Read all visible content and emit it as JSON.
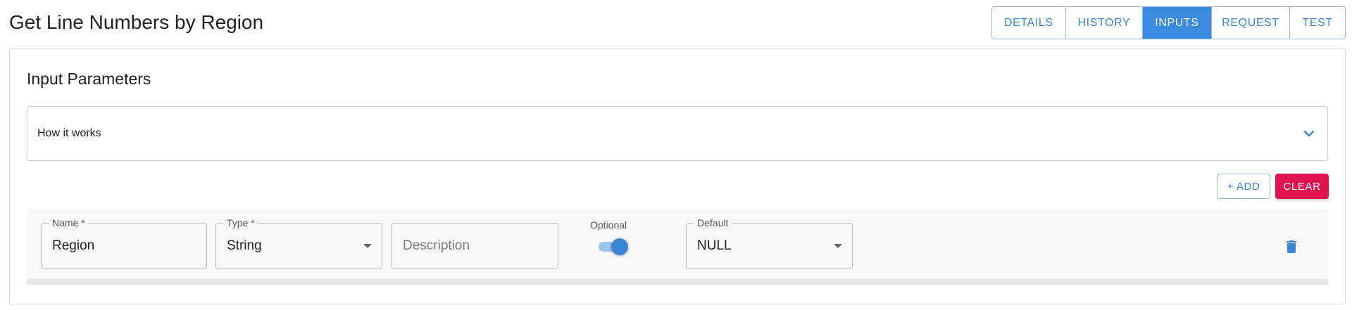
{
  "page": {
    "title": "Get Line Numbers by Region"
  },
  "tabs": [
    {
      "label": "DETAILS",
      "active": false
    },
    {
      "label": "HISTORY",
      "active": false
    },
    {
      "label": "INPUTS",
      "active": true
    },
    {
      "label": "REQUEST",
      "active": false
    },
    {
      "label": "TEST",
      "active": false
    }
  ],
  "section": {
    "title": "Input Parameters"
  },
  "accordion": {
    "label": "How it works",
    "icon": "chevron-down-icon",
    "expanded": false
  },
  "actions": {
    "add_label": "+ ADD",
    "clear_label": "CLEAR"
  },
  "parameter": {
    "name_label": "Name *",
    "name_value": "Region",
    "type_label": "Type *",
    "type_value": "String",
    "description_placeholder": "Description",
    "description_value": "",
    "optional_label": "Optional",
    "optional_on": true,
    "default_label": "Default",
    "default_value": "NULL",
    "delete_icon": "trash-icon"
  },
  "colors": {
    "accent": "#3a8ae0",
    "clear_button": "#e0134f",
    "toggle_thumb": "#3a86d4",
    "toggle_track": "#9cc3ec"
  }
}
